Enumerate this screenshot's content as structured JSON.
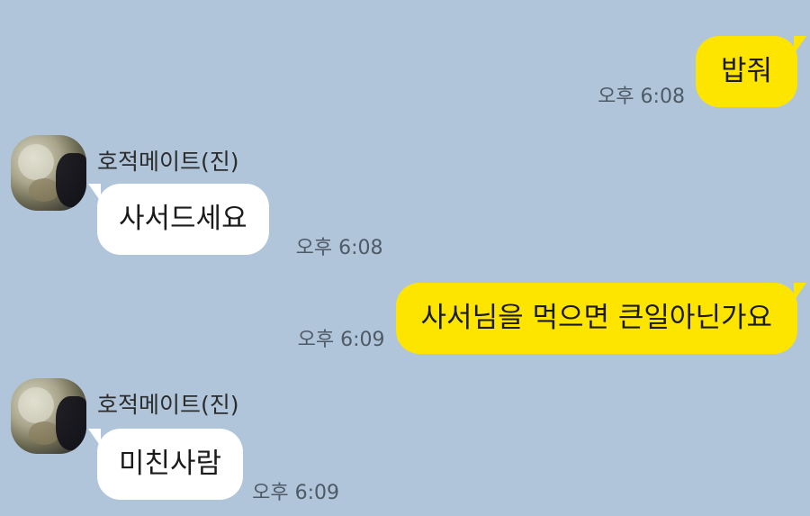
{
  "messages": [
    {
      "direction": "out",
      "text": "밥줘",
      "time": "오후 6:08"
    },
    {
      "direction": "in",
      "sender": "호적메이트(진)",
      "text": "사서드세요",
      "time": "오후 6:08"
    },
    {
      "direction": "out",
      "text": "사서님을 먹으면 큰일아닌가요",
      "time": "오후 6:09"
    },
    {
      "direction": "in",
      "sender": "호적메이트(진)",
      "text": "미친사람",
      "time": "오후 6:09"
    }
  ],
  "colors": {
    "background": "#b1c5da",
    "outgoing_bubble": "#fee500",
    "incoming_bubble": "#ffffff",
    "timestamp": "#4e5a66"
  }
}
